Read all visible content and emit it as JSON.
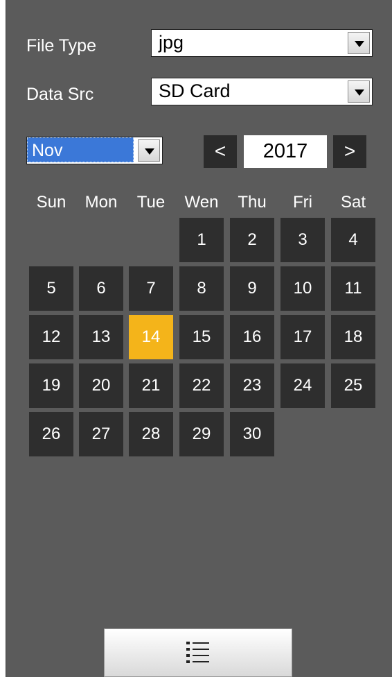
{
  "file_type": {
    "label": "File Type",
    "value": "jpg"
  },
  "data_src": {
    "label": "Data Src",
    "value": "SD Card"
  },
  "month": {
    "value": "Nov"
  },
  "year": {
    "value": "2017",
    "prev_icon": "<",
    "next_icon": ">"
  },
  "weekdays": [
    "Sun",
    "Mon",
    "Tue",
    "Wen",
    "Thu",
    "Fri",
    "Sat"
  ],
  "weeks": [
    [
      "",
      "",
      "",
      "1",
      "2",
      "3",
      "4"
    ],
    [
      "5",
      "6",
      "7",
      "8",
      "9",
      "10",
      "11"
    ],
    [
      "12",
      "13",
      "14",
      "15",
      "16",
      "17",
      "18"
    ],
    [
      "19",
      "20",
      "21",
      "22",
      "23",
      "24",
      "25"
    ],
    [
      "26",
      "27",
      "28",
      "29",
      "30",
      "",
      ""
    ]
  ],
  "selected_day": "14",
  "colors": {
    "panel": "#5b5b5b",
    "day_cell": "#2e2e2e",
    "selected": "#f4b41a",
    "month_highlight": "#3b78d8"
  },
  "list_button_icon": "list-icon"
}
